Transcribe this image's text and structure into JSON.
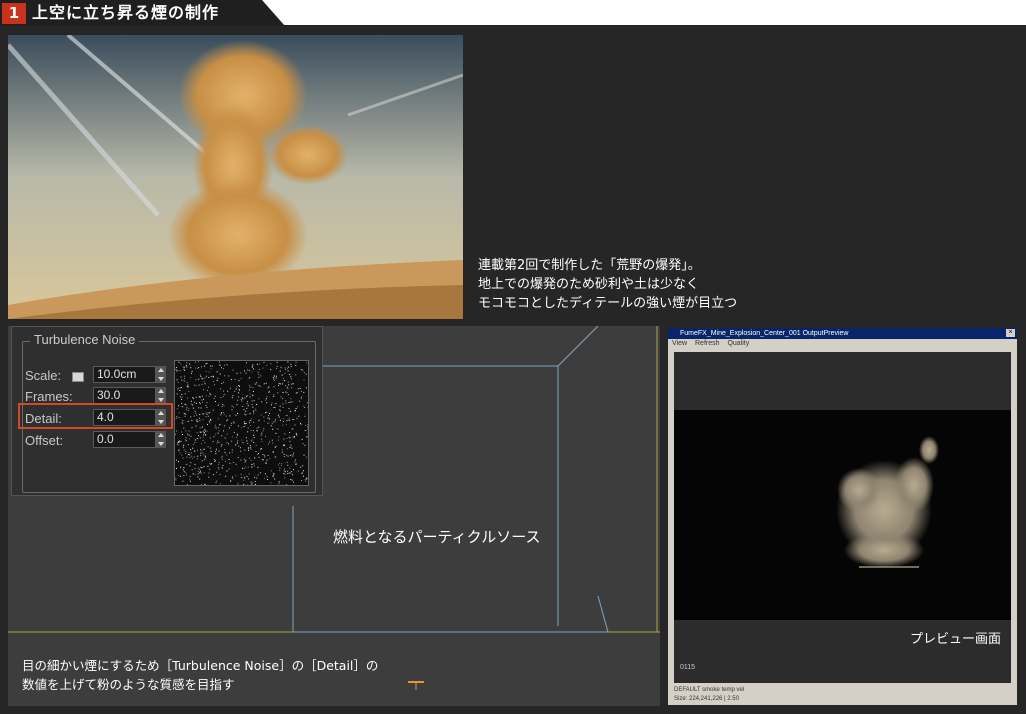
{
  "header": {
    "number": "1",
    "title": "上空に立ち昇る煙の制作"
  },
  "photo_caption": {
    "lines": [
      "連載第2回で制作した「荒野の爆発」。",
      "地上での爆発のため砂利や土は少なく",
      "モコモコとしたディテールの強い煙が目立つ"
    ]
  },
  "turbulence": {
    "group_title": "Turbulence Noise",
    "scale_label": "Scale:",
    "scale_value": "10.0cm",
    "frames_label": "Frames:",
    "frames_value": "30.0",
    "detail_label": "Detail:",
    "detail_value": "4.0",
    "offset_label": "Offset:",
    "offset_value": "0.0"
  },
  "viewport": {
    "particle_caption": "燃料となるパーティクルソース",
    "bottom_caption": [
      "目の細かい煙にするため［Turbulence Noise］の［Detail］の",
      "数値を上げて粉のような質感を目指す"
    ]
  },
  "preview_window": {
    "title": "FumeFX_Mine_Explosion_Center_001 OutputPreview",
    "menu": [
      "View",
      "Refresh",
      "Quality"
    ],
    "frame_number": "0115",
    "label": "プレビュー画面",
    "status_lines": [
      "DEFAULT smoke temp vel",
      "Size: 224,241,226 | 2.50"
    ]
  },
  "colors": {
    "accent_red": "#c8321e",
    "highlight": "#d04a2a",
    "particle": "#5bc8d4"
  }
}
